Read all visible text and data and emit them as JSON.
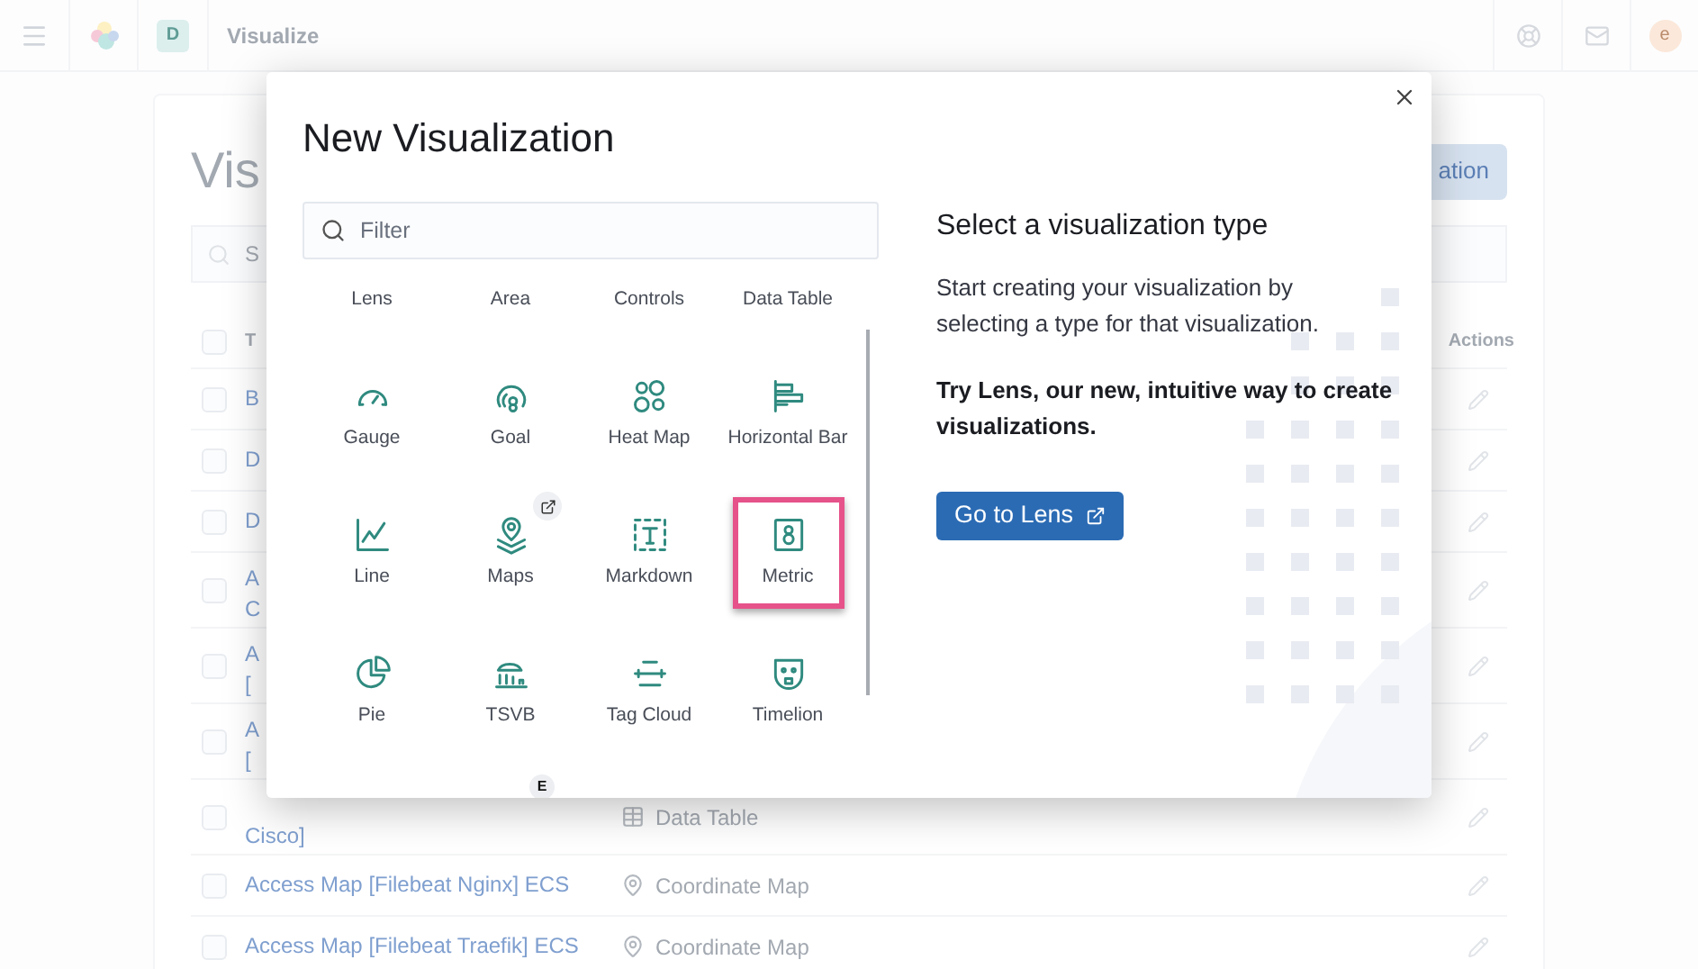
{
  "header": {
    "space_badge": "D",
    "title": "Visualize",
    "avatar": "e"
  },
  "page": {
    "title": "Vis",
    "create_button": "ation",
    "search_placeholder": "S",
    "columns": [
      "T",
      "Actions"
    ],
    "header_checked": false,
    "rows": [
      {
        "lines": [
          "B"
        ],
        "wrapped": false,
        "checked": false
      },
      {
        "lines": [
          "D"
        ],
        "wrapped": false,
        "checked": false
      },
      {
        "lines": [
          "D"
        ],
        "wrapped": false,
        "checked": false
      },
      {
        "lines": [
          "A",
          "C"
        ],
        "wrapped": true,
        "checked": false
      },
      {
        "lines": [
          "A",
          "["
        ],
        "wrapped": true,
        "checked": false
      },
      {
        "lines": [
          "A",
          "["
        ],
        "wrapped": true,
        "checked": false
      },
      {
        "lines": [
          "Cisco]"
        ],
        "wrapped": true,
        "checked": false,
        "type": "Data Table",
        "kind": "table"
      },
      {
        "lines": [
          "Access Map [Filebeat Nginx] ECS"
        ],
        "wrapped": false,
        "checked": false,
        "type": "Coordinate Map",
        "kind": "map"
      },
      {
        "lines": [
          "Access Map [Filebeat Traefik] ECS"
        ],
        "wrapped": false,
        "checked": false,
        "type": "Coordinate Map",
        "kind": "map"
      }
    ]
  },
  "modal": {
    "title": "New Visualization",
    "filter_placeholder": "Filter",
    "types": [
      {
        "label": "Lens",
        "selected": false,
        "external": false
      },
      {
        "label": "Area",
        "selected": false,
        "external": false
      },
      {
        "label": "Controls",
        "selected": false,
        "external": false
      },
      {
        "label": "Data Table",
        "selected": false,
        "external": false
      },
      {
        "label": "Gauge",
        "selected": false,
        "external": false
      },
      {
        "label": "Goal",
        "selected": false,
        "external": false
      },
      {
        "label": "Heat Map",
        "selected": false,
        "external": false
      },
      {
        "label": "Horizontal Bar",
        "selected": false,
        "external": false
      },
      {
        "label": "Line",
        "selected": false,
        "external": false
      },
      {
        "label": "Maps",
        "selected": false,
        "external": true
      },
      {
        "label": "Markdown",
        "selected": false,
        "external": false
      },
      {
        "label": "Metric",
        "selected": true,
        "external": false
      },
      {
        "label": "Pie",
        "selected": false,
        "external": false
      },
      {
        "label": "TSVB",
        "selected": false,
        "external": false
      },
      {
        "label": "Tag Cloud",
        "selected": false,
        "external": false
      },
      {
        "label": "Timelion",
        "selected": false,
        "external": false
      }
    ],
    "floating_badge": "E",
    "heading": "Select a visualization type",
    "description": "Start creating your visualization by selecting a type for that visualization.",
    "promo": "Try Lens, our new, intuitive way to create visualizations.",
    "lens_button": "Go to Lens"
  }
}
